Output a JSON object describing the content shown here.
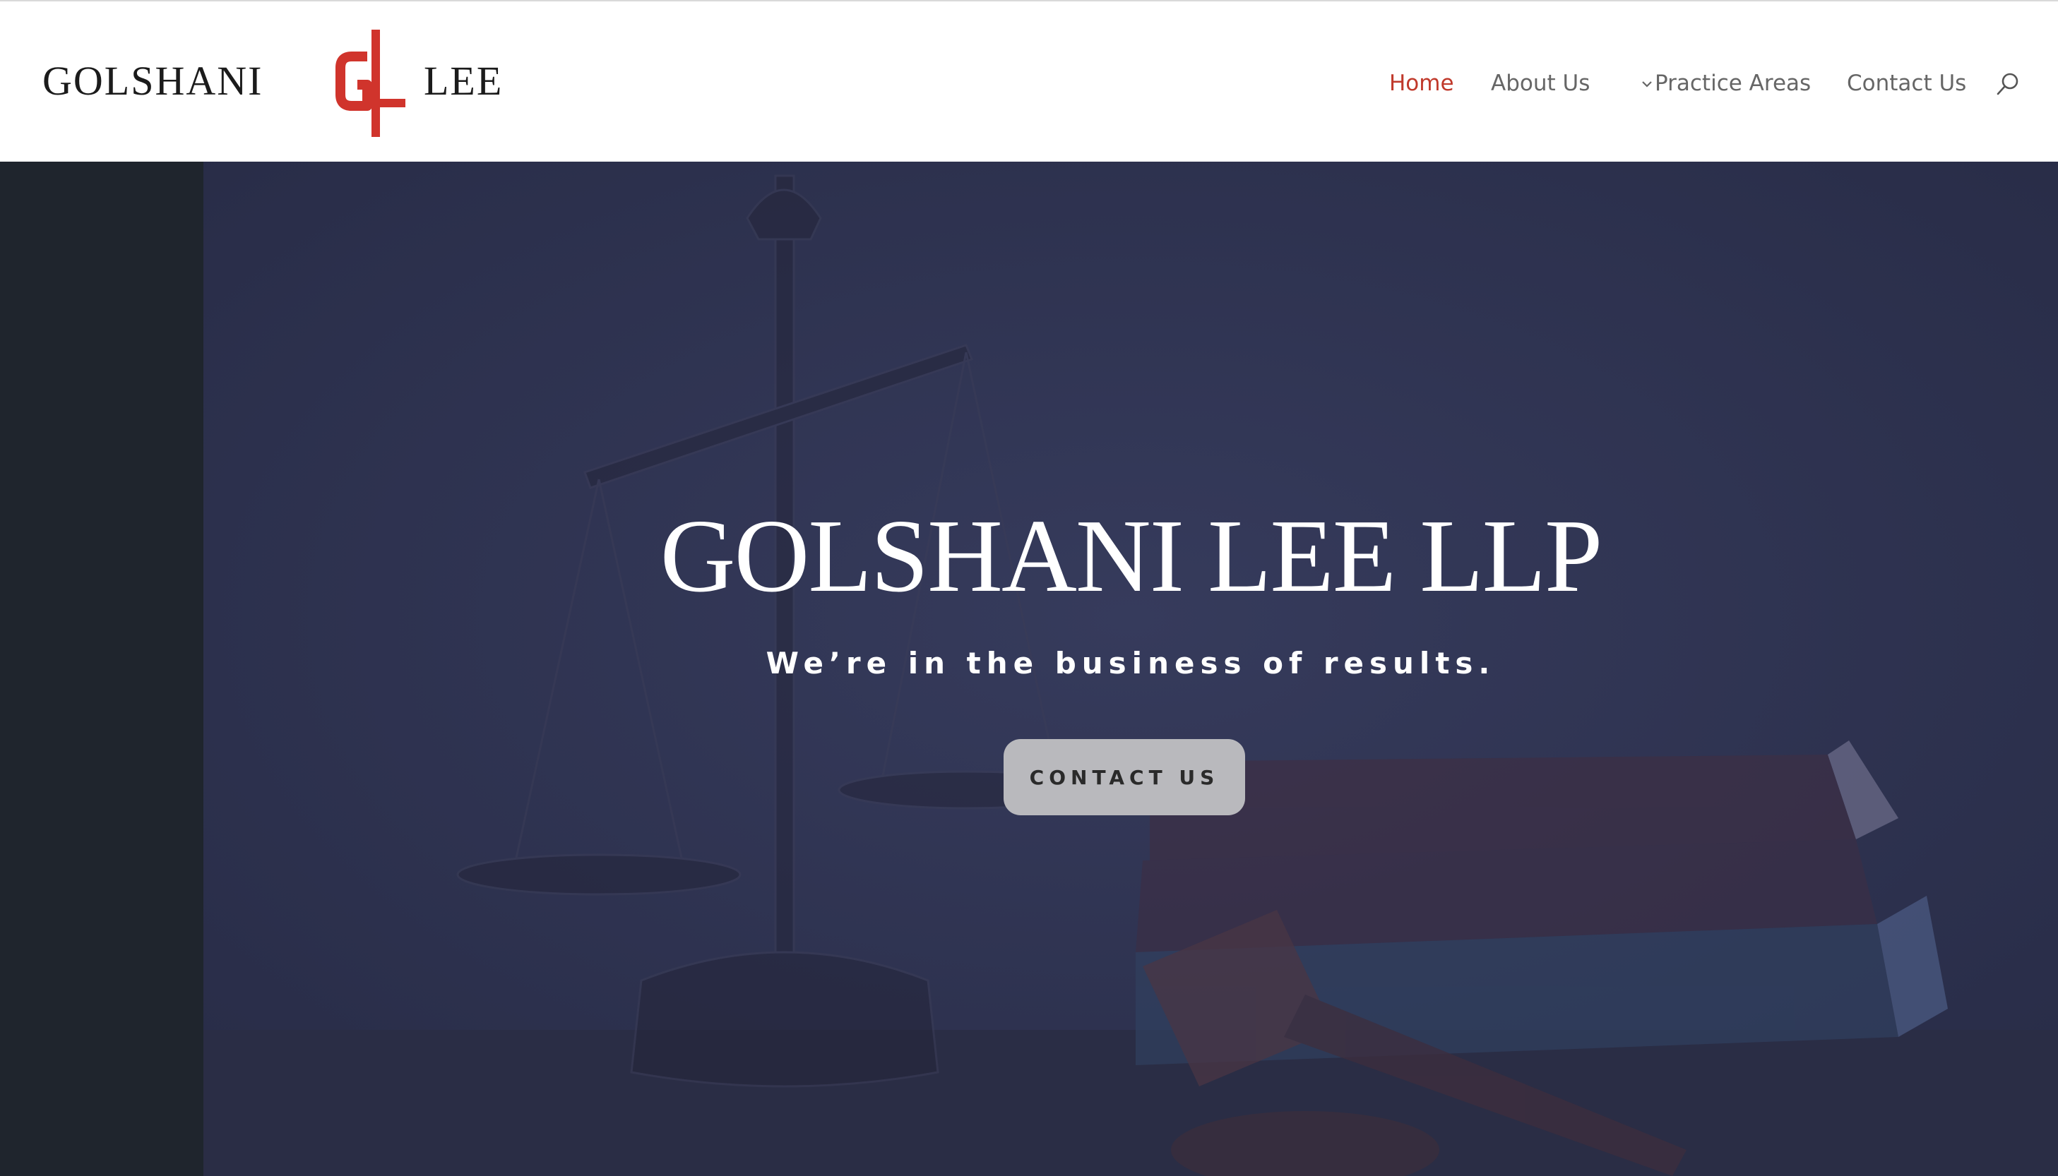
{
  "header": {
    "logo": {
      "word_left": "GOLSHANI",
      "monogram": "GL",
      "word_right": "LEE",
      "monogram_color": "#d0342c"
    },
    "nav": [
      {
        "label": "Home",
        "active": true
      },
      {
        "label": "About Us",
        "has_dropdown": true,
        "icon": "chevron-down-icon"
      },
      {
        "label": "Practice Areas"
      },
      {
        "label": "Contact Us"
      }
    ],
    "search_icon": "search-icon",
    "accent_color": "#c0392b"
  },
  "hero": {
    "title": "GOLSHANI LEE LLP",
    "subtitle": "We’re in the business of results.",
    "cta_label": "CONTACT US",
    "overlay_color": "#2b2f4d"
  }
}
